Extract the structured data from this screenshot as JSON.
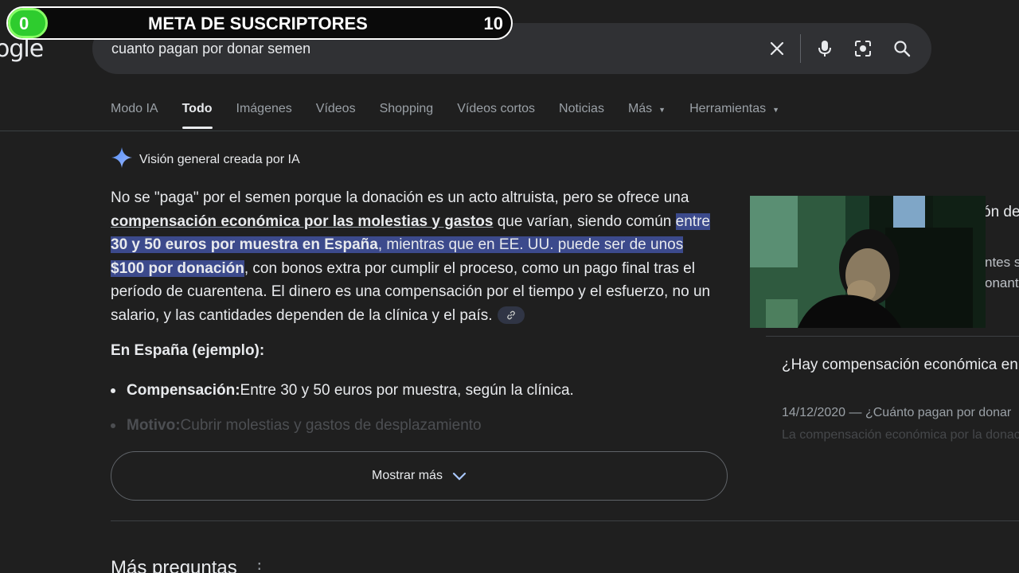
{
  "logo": {
    "text": "ogle"
  },
  "search": {
    "query": "cuanto pagan por donar semen"
  },
  "icons": {
    "clear": "close-icon",
    "voice": "mic-icon",
    "lens": "lens-icon",
    "search": "search-icon"
  },
  "goal": {
    "title": "META DE SUSCRIPTORES",
    "start": "0",
    "end": "10"
  },
  "tabs": [
    {
      "label": "Modo IA"
    },
    {
      "label": "Todo"
    },
    {
      "label": "Imágenes"
    },
    {
      "label": "Vídeos"
    },
    {
      "label": "Shopping"
    },
    {
      "label": "Vídeos cortos"
    },
    {
      "label": "Noticias"
    },
    {
      "label": "Más"
    },
    {
      "label": "Herramientas"
    }
  ],
  "ai": {
    "header": "Visión general creada por IA",
    "p1": "No se \"paga\" por el semen porque la donación es un acto altruista, pero se ofrece una ",
    "p1_bold": "compensación económica por las molestias y gastos",
    "p1_rest": " que varían, siendo común ",
    "hl_pre": "entre ",
    "hl_bold1": "30 y 50 euros por muestra en España",
    "hl_mid": ", mientras que en EE. UU. puede ser de unos ",
    "hl_bold2": "$100 por donación",
    "p2": ", con bonos extra por cumplir el proceso, como un pago final tras el período de cuarentena. El dinero es una compensación por el tiempo y el esfuerzo, no un salario, y las cantidades dependen de la clínica y el país.",
    "section_title": "En España (ejemplo):",
    "bullet1_label": "Compensación:",
    "bullet1_text": " Entre 30 y 50 euros por muestra, según la clínica.",
    "bullet2_label": "Motivo:",
    "bullet2_text": " Cubrir molestias y gastos de desplazamiento",
    "show_more": "Mostrar más"
  },
  "more_questions": "Más preguntas",
  "right": {
    "fragment_a": "ón de",
    "fragment_b": "ntes s",
    "fragment_c": "onante",
    "question": "¿Hay compensación económica en la donación de esperma?",
    "snippet_date": "14/12/2020 — ¿Cuánto pagan por donar",
    "snippet_2": "La compensación económica por la donación"
  }
}
